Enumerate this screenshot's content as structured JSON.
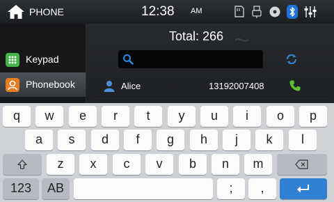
{
  "status": {
    "title": "PHONE",
    "time": "12:38",
    "ampm": "AM"
  },
  "sidebar": {
    "items": [
      {
        "label": "Keypad"
      },
      {
        "label": "Phonebook"
      }
    ]
  },
  "phonebook": {
    "total": "Total: 266"
  },
  "contacts": [
    {
      "name": "Alice",
      "number": "13192007408"
    }
  ],
  "keyboard": {
    "row1": [
      "q",
      "w",
      "e",
      "r",
      "t",
      "y",
      "u",
      "i",
      "o",
      "p"
    ],
    "row2": [
      "a",
      "s",
      "d",
      "f",
      "g",
      "h",
      "j",
      "k",
      "l"
    ],
    "row3": [
      "z",
      "x",
      "c",
      "v",
      "b",
      "n",
      "m"
    ],
    "numbers_label": "123",
    "case_label": "AB",
    "semicolon": ";",
    "comma": ","
  },
  "colors": {
    "accent_blue": "#2f7fd3",
    "call_green": "#5bc236",
    "bluetooth": "#1e73d8"
  },
  "icons": [
    "home-icon",
    "sd-card-icon",
    "usb-icon",
    "disc-icon",
    "bluetooth-icon",
    "equalizer-icon",
    "keypad-icon",
    "phonebook-icon",
    "search-icon",
    "sync-icon",
    "contact-icon",
    "call-icon",
    "shift-icon",
    "backspace-icon",
    "enter-icon"
  ]
}
